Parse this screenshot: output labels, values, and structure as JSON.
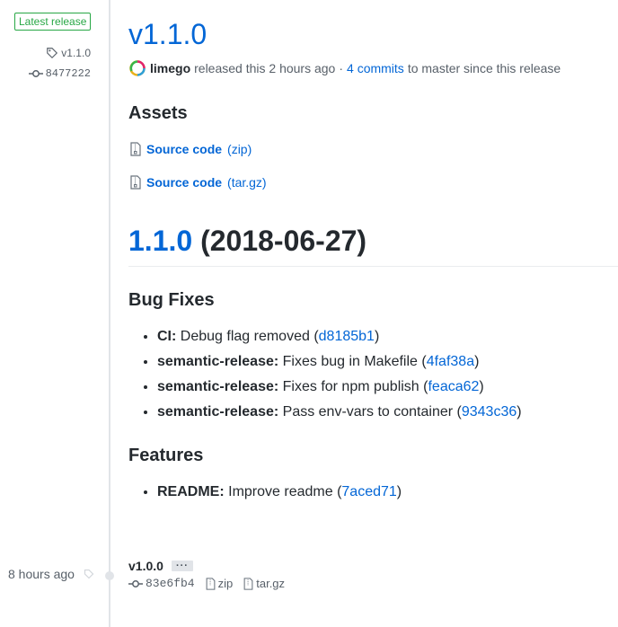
{
  "sidebar": {
    "badge": "Latest release",
    "tag": "v1.1.0",
    "commit": "8477222"
  },
  "release": {
    "title": "v1.1.0",
    "author": "limego",
    "released_text": "released this 2 hours ago",
    "separator": "·",
    "commits_link": "4 commits",
    "commits_suffix": "to master since this release"
  },
  "assets": {
    "heading": "Assets",
    "items": [
      {
        "name": "Source code",
        "ext": "(zip)"
      },
      {
        "name": "Source code",
        "ext": "(tar.gz)"
      }
    ]
  },
  "notes": {
    "version_link": "1.1.0",
    "version_date": "(2018-06-27)",
    "bugfix_heading": "Bug Fixes",
    "bugfixes": [
      {
        "scope": "CI:",
        "text": "Debug flag removed (",
        "hash": "d8185b1",
        "close": ")"
      },
      {
        "scope": "semantic-release:",
        "text": "Fixes bug in Makefile (",
        "hash": "4faf38a",
        "close": ")"
      },
      {
        "scope": "semantic-release:",
        "text": "Fixes for npm publish (",
        "hash": "feaca62",
        "close": ")"
      },
      {
        "scope": "semantic-release:",
        "text": "Pass env-vars to container (",
        "hash": "9343c36",
        "close": ")"
      }
    ],
    "features_heading": "Features",
    "features": [
      {
        "scope": "README:",
        "text": "Improve readme (",
        "hash": "7aced71",
        "close": ")"
      }
    ]
  },
  "older_release": {
    "time": "8 hours ago",
    "tag": "v1.0.0",
    "ellipsis": "···",
    "commit": "83e6fb4",
    "zip": "zip",
    "targz": "tar.gz"
  },
  "colors": {
    "link": "#0366d6",
    "badge_green": "#28a745",
    "muted": "#586069"
  }
}
